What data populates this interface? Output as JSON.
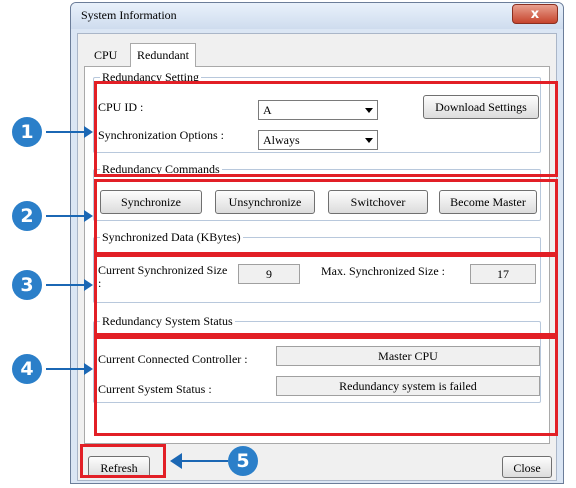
{
  "window": {
    "title": "System Information",
    "close_glyph": "x"
  },
  "tabs": [
    {
      "label": "CPU"
    },
    {
      "label": "Redundant"
    }
  ],
  "redundancy_setting": {
    "group_title": "Redundancy Setting",
    "cpu_id_label": "CPU ID :",
    "cpu_id_value": "A",
    "sync_options_label": "Synchronization Options :",
    "sync_options_value": "Always",
    "download_button": "Download Settings"
  },
  "redundancy_commands": {
    "group_title": "Redundancy Commands",
    "buttons": [
      "Synchronize",
      "Unsynchronize",
      "Switchover",
      "Become Master"
    ]
  },
  "synchronized_data": {
    "group_title": "Synchronized Data (KBytes)",
    "current_label": "Current Synchronized Size :",
    "current_value": "9",
    "max_label": "Max. Synchronized Size :",
    "max_value": "17"
  },
  "system_status": {
    "group_title": "Redundancy System Status",
    "controller_label": "Current Connected Controller :",
    "controller_value": "Master CPU",
    "status_label": "Current System Status :",
    "status_value": "Redundancy system is failed"
  },
  "footer": {
    "refresh_button": "Refresh",
    "close_button": "Close"
  },
  "callouts": [
    "1",
    "2",
    "3",
    "4",
    "5"
  ],
  "colors": {
    "highlight_red": "#e21f26",
    "callout_blue": "#2b7fc9"
  }
}
